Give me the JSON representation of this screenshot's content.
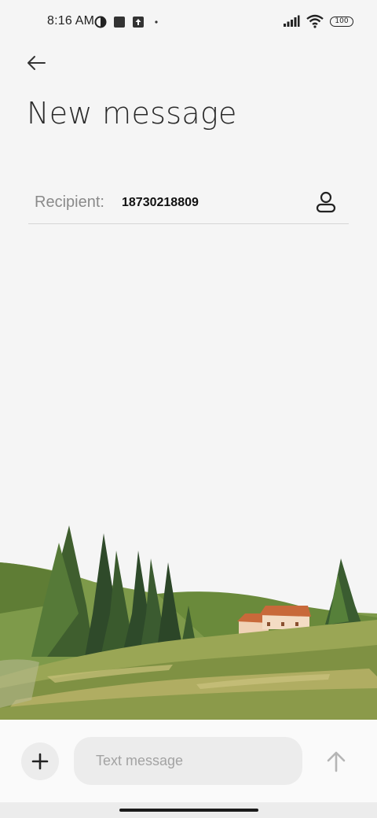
{
  "status_bar": {
    "time": "8:16 AM",
    "icons_left": [
      "data-saver-icon",
      "app-notification-icon",
      "upload-notification-icon",
      "more-dot-icon"
    ],
    "icons_right": [
      "cellular-signal-icon",
      "wifi-icon"
    ],
    "battery": "100"
  },
  "header": {
    "back_icon": "arrow-left-icon",
    "title": "New message"
  },
  "recipient": {
    "label": "Recipient:",
    "value": "18730218809",
    "contact_icon": "person-icon"
  },
  "compose": {
    "attach_icon": "plus-icon",
    "placeholder": "Text message",
    "value": "",
    "send_icon": "arrow-up-icon"
  },
  "colors": {
    "background": "#f5f5f5",
    "input_bg": "#ececec",
    "hill_green": "#6b8a3a",
    "roof_orange": "#c8693a"
  }
}
